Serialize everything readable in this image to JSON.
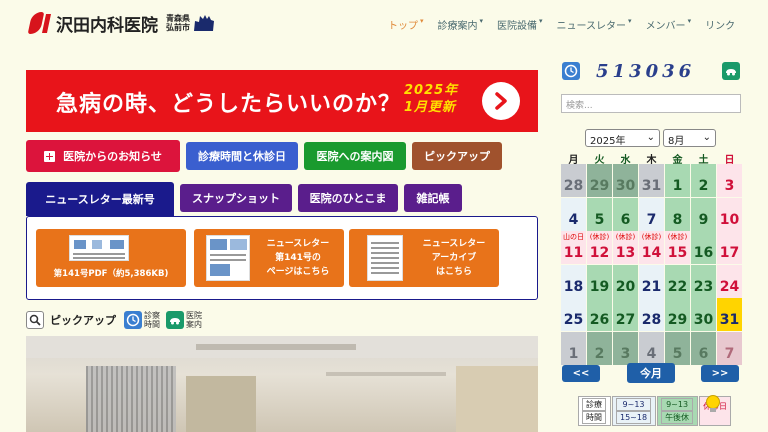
{
  "header": {
    "logo_text": "沢田内科医院",
    "city_line1": "青森県",
    "city_line2": "弘前市",
    "nav": [
      {
        "label": "トップ",
        "dropdown": true,
        "active": true
      },
      {
        "label": "診療案内",
        "dropdown": true,
        "active": false
      },
      {
        "label": "医院設備",
        "dropdown": true,
        "active": false
      },
      {
        "label": "ニュースレター",
        "dropdown": true,
        "active": false
      },
      {
        "label": "メンバー",
        "dropdown": true,
        "active": false
      },
      {
        "label": "リンク",
        "dropdown": false,
        "active": false
      }
    ]
  },
  "banner": {
    "text": "急病の時、どうしたらいいのか？",
    "sub1": "2025年",
    "sub2": "1月更新",
    "icon": "arrow-right-icon"
  },
  "buttons_row1": [
    {
      "label": "医院からのお知らせ",
      "color": "#dc143c"
    },
    {
      "label": "診療時間と休診日",
      "color": "#3a5fcf"
    },
    {
      "label": "医院への案内図",
      "color": "#1a9a2e"
    },
    {
      "label": "ピックアップ",
      "color": "#a0522d"
    }
  ],
  "buttons_row2": [
    {
      "label": "ニュースレター最新号",
      "color": "#1a1a8c"
    },
    {
      "label": "スナップショット",
      "color": "#5a1e8c"
    },
    {
      "label": "医院のひとこま",
      "color": "#5a1e8c"
    },
    {
      "label": "雑記帳",
      "color": "#5a1e8c"
    }
  ],
  "newsletter_cards": [
    {
      "line1": "",
      "line2": "第141号PDF（約5,386KB)"
    },
    {
      "line1": "ニュースレター",
      "line2": "第141号の",
      "line3": "ページはこちら"
    },
    {
      "line1": "ニュースレター",
      "line2": "アーカイブ",
      "line3": "はこちら"
    }
  ],
  "pickup": {
    "title": "ピックアップ",
    "icon1_l1": "診察",
    "icon1_l2": "時間",
    "icon2_l1": "医院",
    "icon2_l2": "案内"
  },
  "sidebar": {
    "counter": "513036",
    "search_placeholder": "検索...",
    "year": "2025年",
    "month": "8月",
    "weekdays": [
      "月",
      "火",
      "水",
      "木",
      "金",
      "土",
      "日"
    ],
    "weekday_colors": [
      "#222",
      "#145a22",
      "#145a22",
      "#222",
      "#145a22",
      "#145a22",
      "#d0103a"
    ],
    "weeks": [
      [
        {
          "d": "28",
          "k": "out"
        },
        {
          "d": "29",
          "k": "outg"
        },
        {
          "d": "30",
          "k": "outg"
        },
        {
          "d": "31",
          "k": "out"
        },
        {
          "d": "1",
          "k": "sat"
        },
        {
          "d": "2",
          "k": "sat"
        },
        {
          "d": "3",
          "k": "hol"
        }
      ],
      [
        {
          "d": "4",
          "k": "norm"
        },
        {
          "d": "5",
          "k": "wed"
        },
        {
          "d": "6",
          "k": "wed"
        },
        {
          "d": "7",
          "k": "thu"
        },
        {
          "d": "8",
          "k": "sat"
        },
        {
          "d": "9",
          "k": "sat"
        },
        {
          "d": "10",
          "k": "hol"
        }
      ],
      [
        {
          "d": "11",
          "k": "hol",
          "t": "山の日"
        },
        {
          "d": "12",
          "k": "hol",
          "t": "(休診)"
        },
        {
          "d": "13",
          "k": "hol",
          "t": "(休診)"
        },
        {
          "d": "14",
          "k": "hol",
          "t": "(休診)"
        },
        {
          "d": "15",
          "k": "hol",
          "t": "(休診)"
        },
        {
          "d": "16",
          "k": "sat"
        },
        {
          "d": "17",
          "k": "hol"
        }
      ],
      [
        {
          "d": "18",
          "k": "norm"
        },
        {
          "d": "19",
          "k": "wed"
        },
        {
          "d": "20",
          "k": "wed"
        },
        {
          "d": "21",
          "k": "thu"
        },
        {
          "d": "22",
          "k": "sat"
        },
        {
          "d": "23",
          "k": "sat"
        },
        {
          "d": "24",
          "k": "hol"
        }
      ],
      [
        {
          "d": "25",
          "k": "norm"
        },
        {
          "d": "26",
          "k": "wed"
        },
        {
          "d": "27",
          "k": "wed"
        },
        {
          "d": "28",
          "k": "thu"
        },
        {
          "d": "29",
          "k": "sat"
        },
        {
          "d": "30",
          "k": "sat"
        },
        {
          "d": "31",
          "k": "today"
        }
      ],
      [
        {
          "d": "1",
          "k": "out"
        },
        {
          "d": "2",
          "k": "outg"
        },
        {
          "d": "3",
          "k": "outg"
        },
        {
          "d": "4",
          "k": "out"
        },
        {
          "d": "5",
          "k": "outg"
        },
        {
          "d": "6",
          "k": "outg"
        },
        {
          "d": "7",
          "k": "outp"
        }
      ]
    ],
    "prev": "<<",
    "current": "今月",
    "next": ">>",
    "legend": {
      "label_l1": "診療",
      "label_l2": "時間",
      "a_l1": "9~13",
      "a_l2": "15~18",
      "b_l1": "9~13",
      "b_l2": "午後休",
      "c": "休診日"
    }
  }
}
